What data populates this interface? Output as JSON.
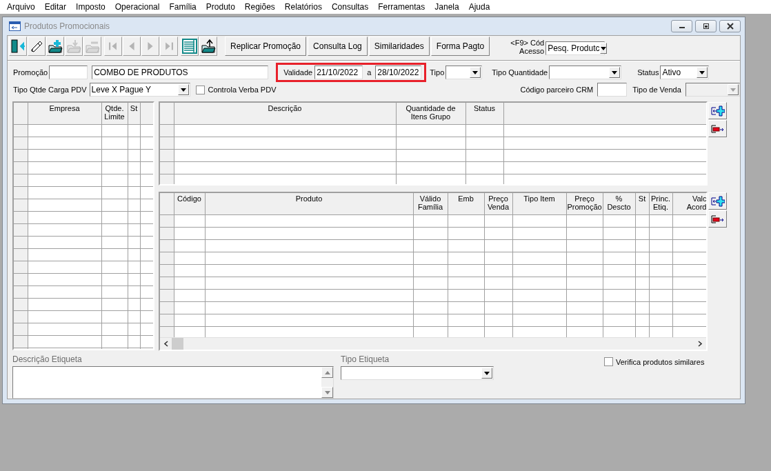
{
  "menu_bar": [
    {
      "label": "Arquivo"
    },
    {
      "label": "Editar"
    },
    {
      "label": "Imposto"
    },
    {
      "label": "Operacional"
    },
    {
      "label": "Família"
    },
    {
      "label": "Produto"
    },
    {
      "label": "Regiões"
    },
    {
      "label": "Relatórios"
    },
    {
      "label": "Consultas"
    },
    {
      "label": "Ferramentas"
    },
    {
      "label": "Janela"
    },
    {
      "label": "Ajuda"
    }
  ],
  "window": {
    "title": "Produtos Promocionais"
  },
  "toolbar": {
    "icon_buttons": [
      {
        "kind": "exit",
        "disabled": false
      },
      {
        "kind": "edit",
        "disabled": false
      },
      {
        "kind": "add",
        "disabled": false
      },
      {
        "kind": "import",
        "disabled": true
      },
      {
        "kind": "remove",
        "disabled": true
      },
      {
        "kind": "first",
        "disabled": true
      },
      {
        "kind": "previous",
        "disabled": true
      },
      {
        "kind": "next",
        "disabled": true
      },
      {
        "kind": "last",
        "disabled": true
      },
      {
        "kind": "grid",
        "disabled": false
      },
      {
        "kind": "export",
        "disabled": false
      }
    ],
    "buttons": [
      {
        "label": "Replicar Promoção"
      },
      {
        "label": "Consulta Log"
      },
      {
        "label": "Similaridades"
      },
      {
        "label": "Forma Pagto"
      }
    ],
    "access_code": {
      "label": "<F9> Cód Acesso",
      "value": "Pesq. Produtc"
    }
  },
  "form": {
    "promocao": {
      "label": "Promoção",
      "name": "COMBO DE PRODUTOS"
    },
    "validade": {
      "label": "Validade",
      "highlighted": true,
      "from": "21/10/2022",
      "separator": "a",
      "to": "28/10/2022"
    },
    "tipo": {
      "label": "Tipo"
    },
    "tipo_quantidade": {
      "label": "Tipo Quantidade"
    },
    "status": {
      "label": "Status",
      "value": "Ativo"
    },
    "tipo_qtde_carga_pdv": {
      "label": "Tipo Qtde Carga PDV",
      "value": "Leve X Pague Y"
    },
    "controla_verba_pdv": {
      "label": "Controla Verba PDV",
      "checked": false
    },
    "codigo_parceiro_crm": {
      "label": "Código parceiro CRM"
    },
    "tipo_de_venda": {
      "label": "Tipo de Venda",
      "disabled": true
    }
  },
  "empresa_grid": {
    "columns": [
      {
        "header": "Empresa"
      },
      {
        "header": "Qtde. Limite"
      },
      {
        "header": "St"
      }
    ]
  },
  "grupo_grid": {
    "columns": [
      {
        "header": "Descrição"
      },
      {
        "header": "Quantidade de Itens Grupo"
      },
      {
        "header": "Status"
      }
    ]
  },
  "produto_grid": {
    "columns": [
      {
        "header": "Código"
      },
      {
        "header": "Produto"
      },
      {
        "header": "Válido Família"
      },
      {
        "header": "Emb"
      },
      {
        "header": "Preço Venda"
      },
      {
        "header": "Tipo Item"
      },
      {
        "header": "Preço Promoção"
      },
      {
        "header": "% Descto"
      },
      {
        "header": "St"
      },
      {
        "header": "Princ. Etiq."
      },
      {
        "header": "Valc Acord"
      }
    ]
  },
  "descricao_etiqueta": {
    "label": "Descrição Etiqueta"
  },
  "tipo_etiqueta": {
    "label": "Tipo Etiqueta"
  },
  "verifica_produtos_similares": {
    "label": "Verifica produtos similares",
    "checked": false
  }
}
